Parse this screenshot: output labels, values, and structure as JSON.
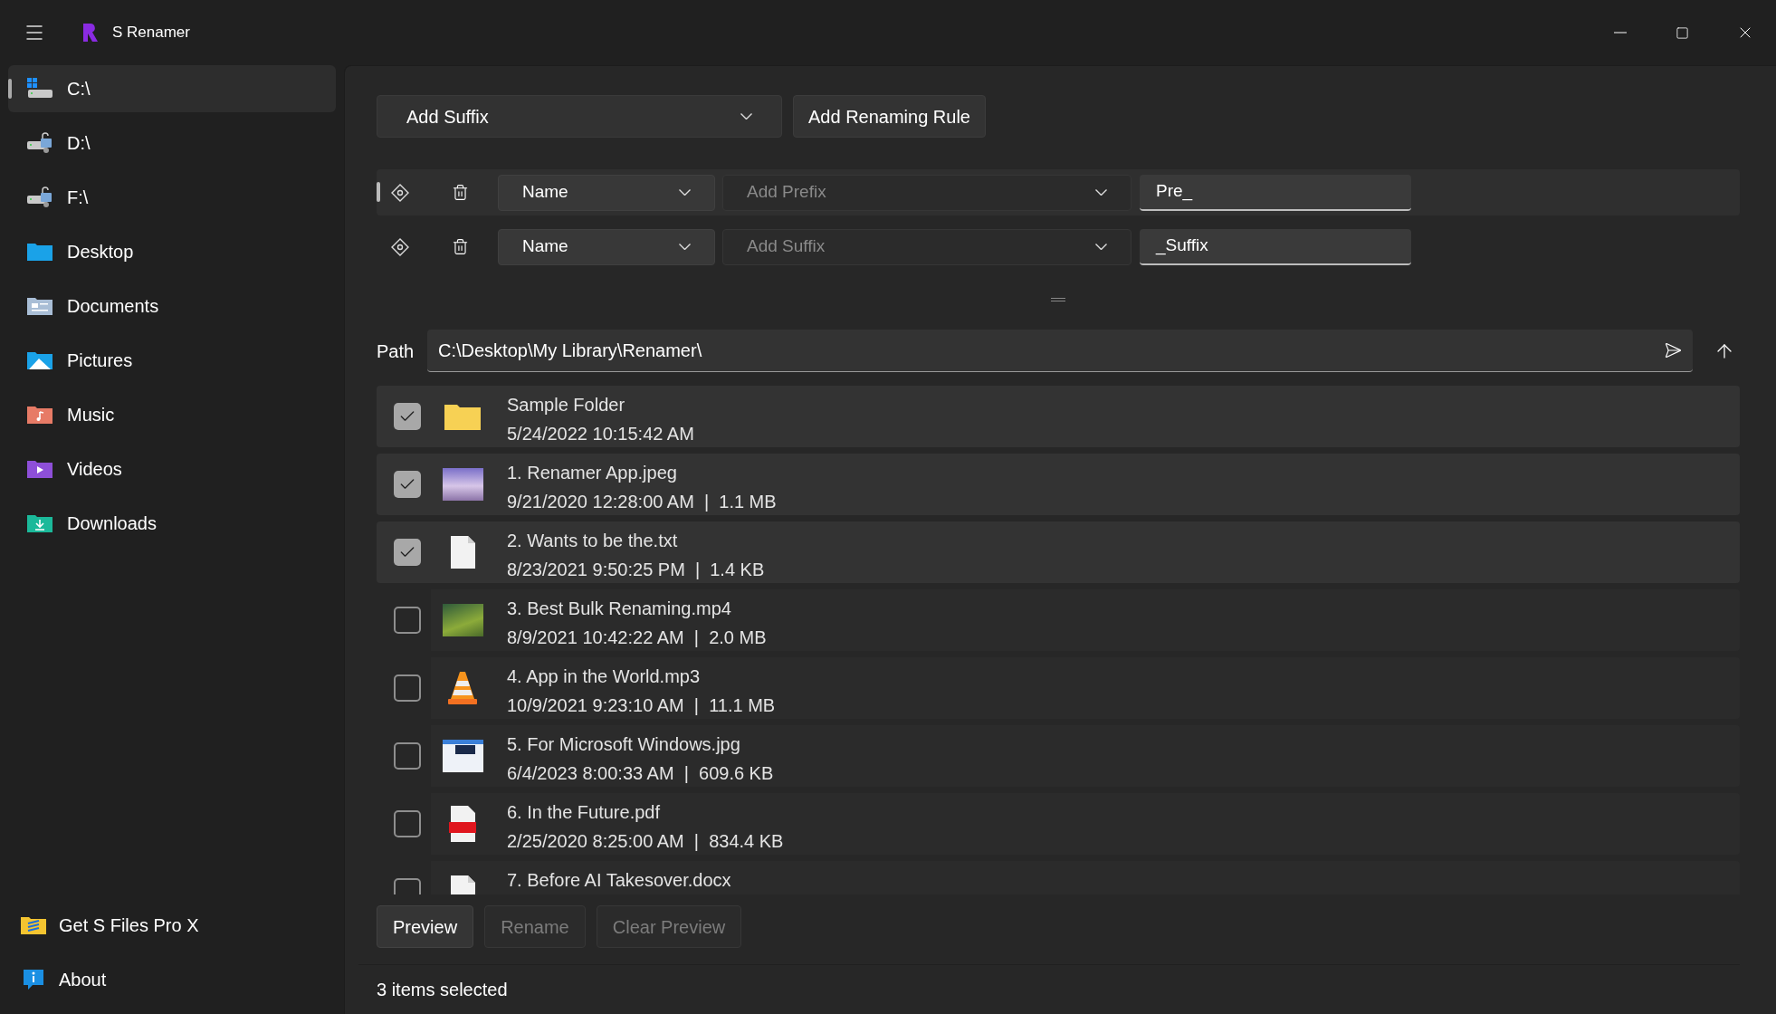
{
  "window": {
    "title": "S Renamer"
  },
  "sidebar": {
    "items": [
      {
        "label": "C:\\",
        "kind": "system-drive",
        "selected": true
      },
      {
        "label": "D:\\",
        "kind": "drive",
        "selected": false
      },
      {
        "label": "F:\\",
        "kind": "drive",
        "selected": false
      },
      {
        "label": "Desktop",
        "kind": "desktop",
        "selected": false
      },
      {
        "label": "Documents",
        "kind": "documents",
        "selected": false
      },
      {
        "label": "Pictures",
        "kind": "pictures",
        "selected": false
      },
      {
        "label": "Music",
        "kind": "music",
        "selected": false
      },
      {
        "label": "Videos",
        "kind": "videos",
        "selected": false
      },
      {
        "label": "Downloads",
        "kind": "downloads",
        "selected": false
      }
    ],
    "footer_items": [
      {
        "label": "Get S Files Pro X",
        "kind": "promo"
      },
      {
        "label": "About",
        "kind": "info"
      }
    ]
  },
  "rule_picker": {
    "value": "Add Suffix",
    "button": "Add Renaming Rule"
  },
  "rules": [
    {
      "selected": true,
      "target": "Name",
      "operation": "Add Prefix",
      "value": "Pre_"
    },
    {
      "selected": false,
      "target": "Name",
      "operation": "Add Suffix",
      "value": "_Suffix"
    }
  ],
  "path": {
    "label": "Path",
    "value": "C:\\Desktop\\My Library\\Renamer\\"
  },
  "files": [
    {
      "kind": "folder",
      "checked": true,
      "name": "Sample Folder",
      "details": "5/24/2022 10:15:42 AM"
    },
    {
      "kind": "image",
      "checked": true,
      "name": "1. Renamer App.jpeg",
      "details": "9/21/2020 12:28:00 AM  |  1.1 MB"
    },
    {
      "kind": "text",
      "checked": true,
      "name": "2. Wants to be the.txt",
      "details": "8/23/2021 9:50:25 PM  |  1.4 KB"
    },
    {
      "kind": "video",
      "checked": false,
      "name": "3. Best Bulk Renaming.mp4",
      "details": "8/9/2021 10:42:22 AM  |  2.0 MB"
    },
    {
      "kind": "audio",
      "checked": false,
      "name": "4. App in the World.mp3",
      "details": "10/9/2021 9:23:10 AM  |  11.1 MB"
    },
    {
      "kind": "screenshot",
      "checked": false,
      "name": "5. For Microsoft Windows.jpg",
      "details": "6/4/2023 8:00:33 AM  |  609.6 KB"
    },
    {
      "kind": "pdf",
      "checked": false,
      "name": "6. In the Future.pdf",
      "details": "2/25/2020 8:25:00 AM  |  834.4 KB"
    },
    {
      "kind": "text",
      "checked": false,
      "name": "7. Before AI Takesover.docx"
    }
  ],
  "buttons": [
    {
      "label": "Preview",
      "disabled": false
    },
    {
      "label": "Rename",
      "disabled": true
    },
    {
      "label": "Clear Preview",
      "disabled": true
    }
  ],
  "status_bar": "3 items selected"
}
